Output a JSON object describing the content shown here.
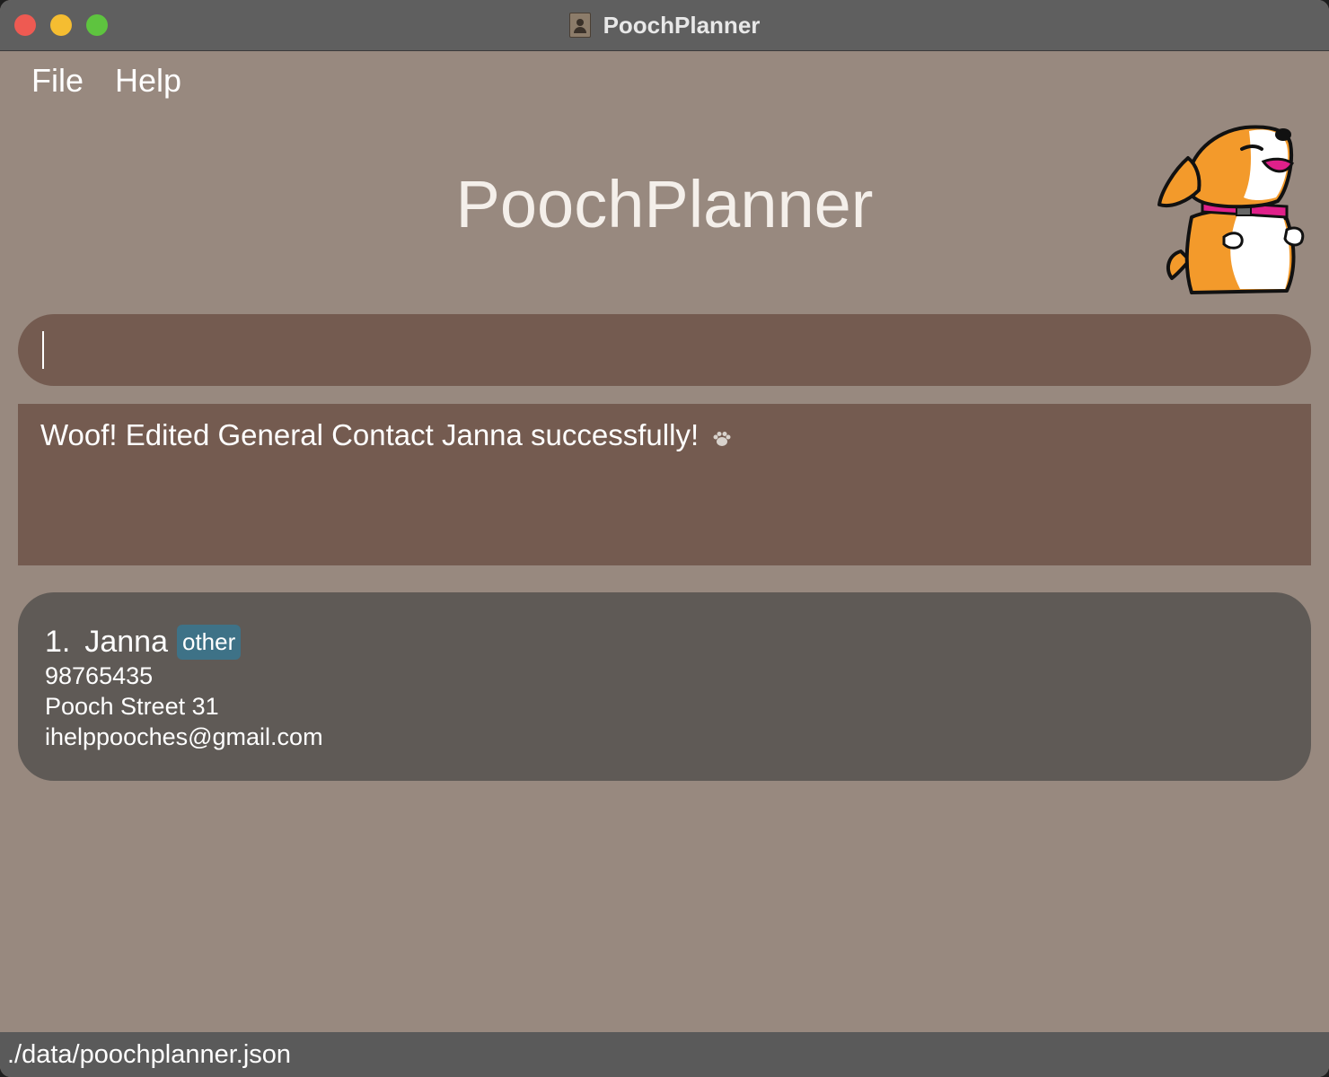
{
  "window": {
    "title": "PoochPlanner"
  },
  "menu": {
    "file": "File",
    "help": "Help"
  },
  "header": {
    "app_title": "PoochPlanner",
    "mascot_icon": "dog-mascot-icon"
  },
  "command": {
    "value": "",
    "placeholder": ""
  },
  "result": {
    "message": "Woof! Edited General Contact Janna successfully!",
    "icon": "paw-icon"
  },
  "contacts": [
    {
      "index": "1.",
      "name": "Janna",
      "tag": "other",
      "phone": "98765435",
      "address": "Pooch Street 31",
      "email": "ihelppooches@gmail.com"
    }
  ],
  "status": {
    "file_path": "./data/poochplanner.json"
  },
  "colors": {
    "background": "#98897f",
    "command_box": "#745b50",
    "list_panel": "#5f5a56",
    "tag": "#3e7287",
    "titlebar": "#5f5f5f",
    "statusbar": "#5a5a5a"
  }
}
